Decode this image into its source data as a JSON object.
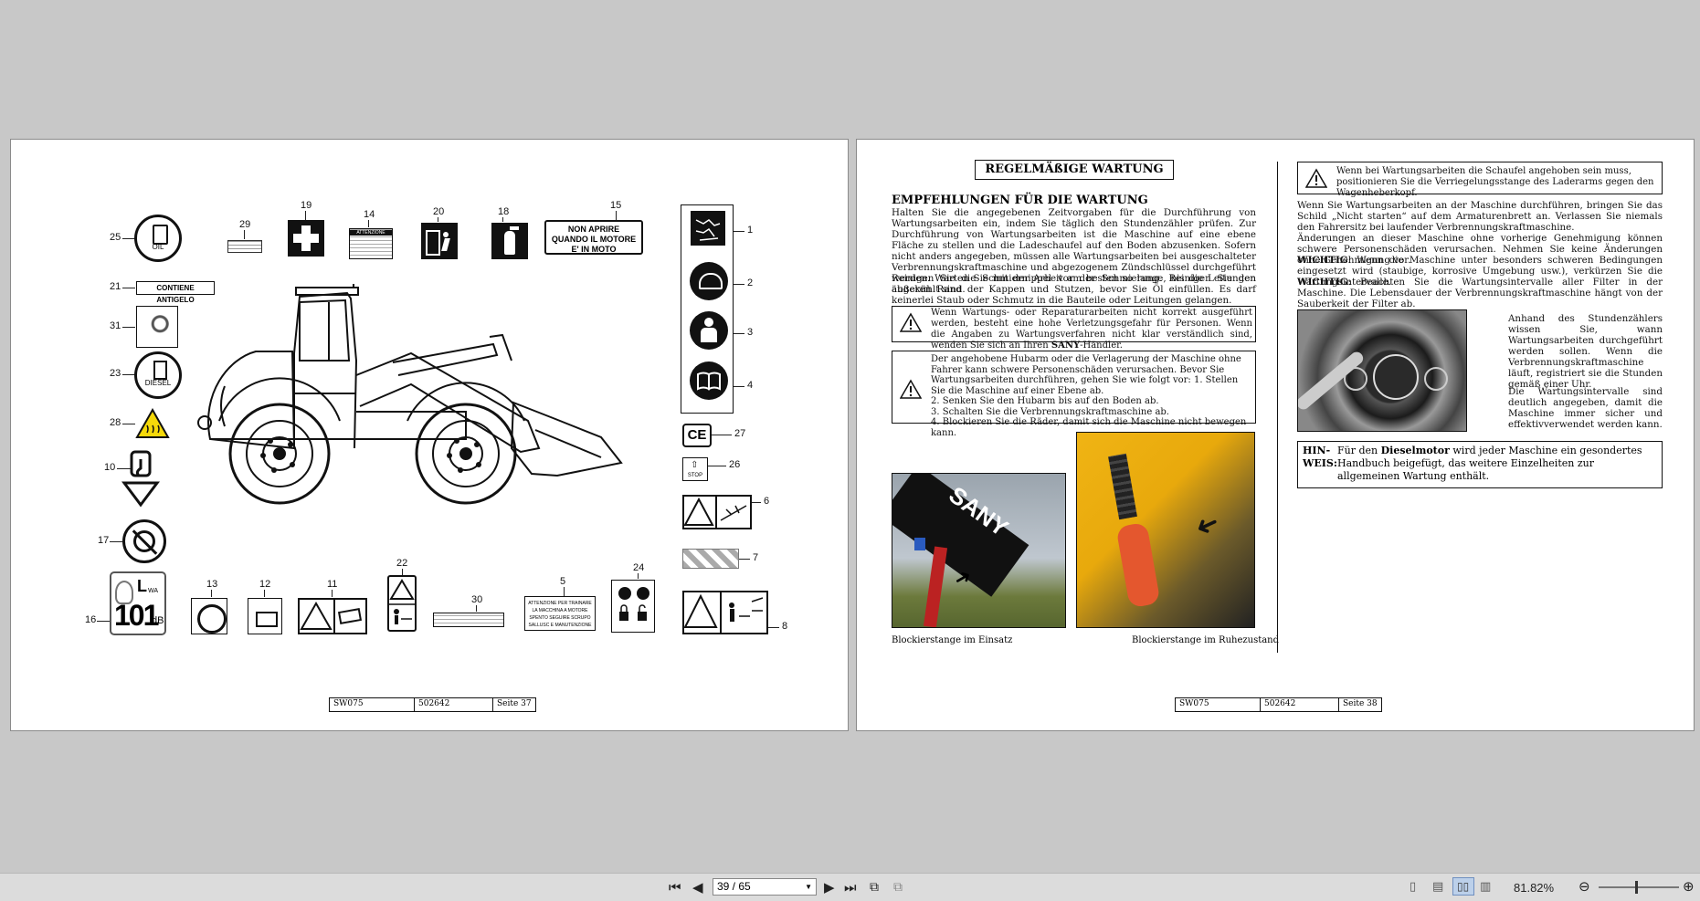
{
  "left_page": {
    "labels": {
      "s25": "25",
      "s29": "29",
      "s19": "19",
      "s14": "14",
      "s20": "20",
      "s18": "18",
      "s15": "15",
      "s21": "21",
      "s31": "31",
      "s23": "23",
      "s28": "28",
      "s10": "10",
      "s17": "17",
      "s16": "16",
      "s13": "13",
      "s12": "12",
      "s11": "11",
      "s22": "22",
      "s30": "30",
      "s5": "5",
      "s24": "24",
      "s1": "1",
      "s2": "2",
      "s3": "3",
      "s4": "4",
      "s27": "27",
      "s26": "26",
      "s6": "6",
      "s7": "7",
      "s8": "8"
    },
    "oil_text": "OIL",
    "diesel_text": "DIESEL",
    "antifreeze_text": "CONTIENE ANTIGELO",
    "warn15_lines": [
      "NON APRIRE",
      "QUANDO IL MOTORE",
      "E' IN MOTO"
    ],
    "attenzione_text": "ATTENZIONE",
    "noise_lwa": "L",
    "noise_wa_sub": "WA",
    "noise_value": "101",
    "noise_unit": "dB",
    "stop_text": "STOP",
    "ce_text": "CE",
    "sign5_lines": [
      "ATTENZIONE PER TRAINARE",
      "LA MACCHINA A MOTORE",
      "SPENTO SEGUIRE SCRUPO",
      "SALLUSC E MANUTENZIONE"
    ],
    "footer": {
      "model": "SW075",
      "code": "502642",
      "page": "Seite 37"
    }
  },
  "right_page": {
    "title": "REGELMÄßIGE WARTUNG",
    "heading": "EMPFEHLUNGEN FÜR DIE WARTUNG",
    "para1": "Halten Sie die angegebenen Zeitvorgaben für die Durchführung von Wartungsarbeiten ein, indem Sie täglich den Stundenzähler prüfen. Zur Durchführung von Wartungsarbeiten ist die Maschine auf eine ebene Fläche zu stellen und die Ladeschaufel auf den Boden abzusenken. Sofern nicht anders angegeben, müssen alle Wartungsarbeiten bei ausgeschalteter Verbrennungskraftmaschine und abgezogenem Zündschlüssel durchgeführt werden. Warten Sie mit der Arbeit am besten so lange, bis die Leitungen abgekühlt sind.",
    "para2": "Reinigen Sie die Schmiernippel vor der Schmierung. Reinigen Sie den äußeren Rand der Kappen und Stutzen, bevor Sie Öl einfüllen. Es darf keinerlei Staub oder Schmutz in die Bauteile oder Leitungen gelangen.",
    "warn1_a": "Wenn Wartungs- oder Reparaturarbeiten nicht korrekt ausgeführt werden, besteht eine hohe Verletzungsgefahr für Personen. Wenn die Angaben zu Wartungsverfahren nicht klar verständlich sind, wenden Sie sich an Ihren ",
    "warn1_brand": "SANY",
    "warn1_b": "-Händler.",
    "warn2_lines": [
      "Der angehobene Hubarm oder die Verlagerung der Maschine ohne Fahrer kann schwere Personenschäden verursachen. Bevor Sie Wartungsarbeiten durchführen, gehen Sie wie folgt vor: 1. Stellen Sie die Maschine auf einer Ebene ab.",
      "2. Senken Sie den Hubarm bis auf den Boden ab.",
      "3. Schalten Sie die Verbrennungskraftmaschine ab.",
      "4. Blockieren Sie die Räder, damit sich die Maschine nicht bewegen kann."
    ],
    "photo1_brand": "SANY",
    "caption1": "Blockierstange im Einsatz",
    "caption2": "Blockierstange im Ruhezustand",
    "warn3": "Wenn bei Wartungsarbeiten die Schaufel angehoben sein muss, positionieren Sie die Verriegelungsstange des Laderarms gegen den Wagenheberkopf.",
    "col2_p1": "Wenn Sie Wartungsarbeiten an der Maschine durchführen, bringen Sie das Schild „Nicht starten“ auf dem Armaturenbrett an. Verlassen Sie niemals den Fahrersitz bei laufender Verbrennungskraftmaschine.",
    "col2_p2": "Änderungen an dieser Maschine ohne vorherige Genehmigung können schwere Personenschäden verursachen. Nehmen Sie keine Änderungen ohne Genehmigung vor.",
    "wichtig_label": "WICHTIG",
    "col2_p3": ": Wenn die Maschine unter besonders schweren Bedingungen eingesetzt wird (staubige, korrosive Umgebung usw.), verkürzen Sie die Wartungsintervalle.",
    "col2_p4": ": Beachten Sie die Wartungsintervalle aller Filter in der Maschine. Die Lebensdauer der Verbrennungskraftmaschine hängt von der Sauberkeit der Filter ab.",
    "side_p1": "Anhand des Stundenzählers wissen Sie, wann Wartungsarbeiten durchgeführt werden sollen. Wenn die Verbrennungskraftmaschine läuft, registriert sie die Stunden gemäß einer Uhr.",
    "side_p2": "Die Wartungsintervalle sind deutlich angegeben, damit die Maschine immer sicher und effektivverwendet werden kann.",
    "hinweis_label_1": "HIN-",
    "hinweis_label_2": "WEIS:",
    "hinweis_a": "Für den ",
    "hinweis_bold": "Dieselmotor",
    "hinweis_b": " wird jeder Maschine ein gesondertes Handbuch beigefügt, das weitere Einzelheiten zur allgemeinen Wartung enthält.",
    "footer": {
      "model": "SW075",
      "code": "502642",
      "page": "Seite 38"
    }
  },
  "toolbar": {
    "page_value": "39 / 65",
    "zoom": "81.82%"
  }
}
